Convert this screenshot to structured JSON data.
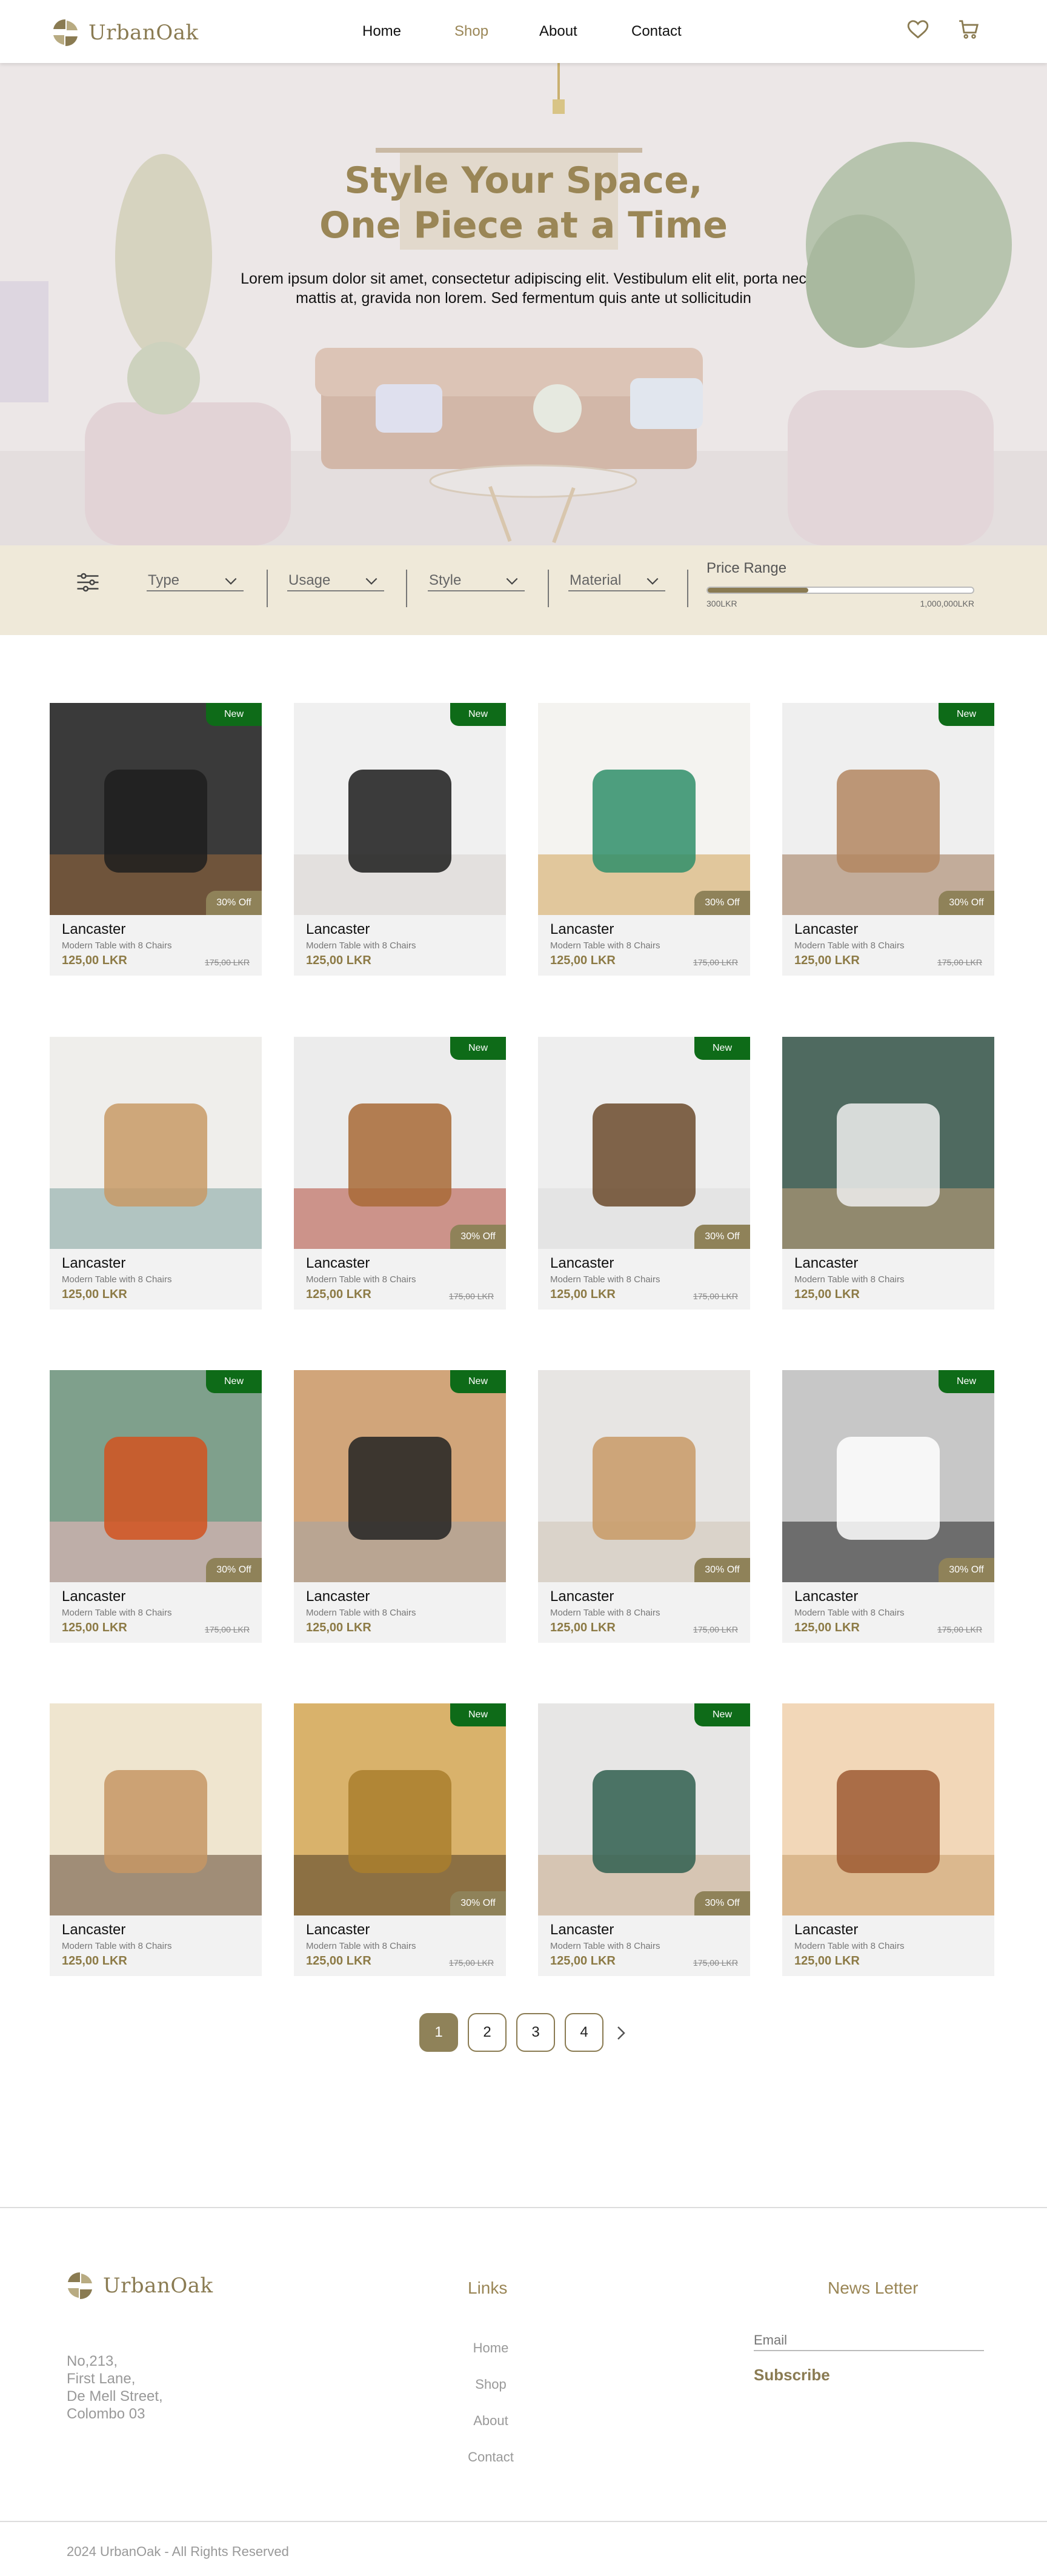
{
  "header": {
    "brand": "UrbanOak",
    "nav": [
      {
        "label": "Home",
        "active": false
      },
      {
        "label": "Shop",
        "active": true
      },
      {
        "label": "About",
        "active": false
      },
      {
        "label": "Contact",
        "active": false
      }
    ],
    "icons": [
      "heart-icon",
      "cart-icon"
    ]
  },
  "hero": {
    "title_line1": "Style Your Space,",
    "title_line2": "One Piece at a Time",
    "subtitle": "Lorem ipsum dolor sit amet, consectetur adipiscing elit. Vestibulum elit elit, porta nec mattis at, gravida non lorem. Sed fermentum quis ante ut sollicitudin"
  },
  "filters": {
    "selects": [
      "Type",
      "Usage",
      "Style",
      "Material"
    ],
    "price_range": {
      "label": "Price Range",
      "min_label": "300LKR",
      "max_label": "1,000,000LKR",
      "selected_fraction": 0.38
    }
  },
  "products": [
    {
      "name": "Lancaster",
      "desc": "Modern Table with 8 Chairs",
      "price": "125,00 LKR",
      "old_price": "175,00 LKR",
      "new": true,
      "discount": "30% Off"
    },
    {
      "name": "Lancaster",
      "desc": "Modern Table with 8 Chairs",
      "price": "125,00 LKR",
      "old_price": "",
      "new": true,
      "discount": ""
    },
    {
      "name": "Lancaster",
      "desc": "Modern Table with 8 Chairs",
      "price": "125,00 LKR",
      "old_price": "175,00 LKR",
      "new": false,
      "discount": "30% Off"
    },
    {
      "name": "Lancaster",
      "desc": "Modern Table with 8 Chairs",
      "price": "125,00 LKR",
      "old_price": "175,00 LKR",
      "new": true,
      "discount": "30% Off"
    },
    {
      "name": "Lancaster",
      "desc": "Modern Table with 8 Chairs",
      "price": "125,00 LKR",
      "old_price": "",
      "new": false,
      "discount": ""
    },
    {
      "name": "Lancaster",
      "desc": "Modern Table with 8 Chairs",
      "price": "125,00 LKR",
      "old_price": "175,00 LKR",
      "new": true,
      "discount": "30% Off"
    },
    {
      "name": "Lancaster",
      "desc": "Modern Table with 8 Chairs",
      "price": "125,00 LKR",
      "old_price": "175,00 LKR",
      "new": true,
      "discount": "30% Off"
    },
    {
      "name": "Lancaster",
      "desc": "Modern Table with 8 Chairs",
      "price": "125,00 LKR",
      "old_price": "",
      "new": false,
      "discount": ""
    },
    {
      "name": "Lancaster",
      "desc": "Modern Table with 8 Chairs",
      "price": "125,00 LKR",
      "old_price": "175,00 LKR",
      "new": true,
      "discount": "30% Off"
    },
    {
      "name": "Lancaster",
      "desc": "Modern Table with 8 Chairs",
      "price": "125,00 LKR",
      "old_price": "",
      "new": true,
      "discount": ""
    },
    {
      "name": "Lancaster",
      "desc": "Modern Table with 8 Chairs",
      "price": "125,00 LKR",
      "old_price": "175,00 LKR",
      "new": false,
      "discount": "30% Off"
    },
    {
      "name": "Lancaster",
      "desc": "Modern Table with 8 Chairs",
      "price": "125,00 LKR",
      "old_price": "175,00 LKR",
      "new": true,
      "discount": "30% Off"
    },
    {
      "name": "Lancaster",
      "desc": "Modern Table with 8 Chairs",
      "price": "125,00 LKR",
      "old_price": "",
      "new": false,
      "discount": ""
    },
    {
      "name": "Lancaster",
      "desc": "Modern Table with 8 Chairs",
      "price": "125,00 LKR",
      "old_price": "175,00 LKR",
      "new": true,
      "discount": "30% Off"
    },
    {
      "name": "Lancaster",
      "desc": "Modern Table with 8 Chairs",
      "price": "125,00 LKR",
      "old_price": "175,00 LKR",
      "new": true,
      "discount": "30% Off"
    },
    {
      "name": "Lancaster",
      "desc": "Modern Table with 8 Chairs",
      "price": "125,00 LKR",
      "old_price": "",
      "new": false,
      "discount": ""
    }
  ],
  "pagination": {
    "pages": [
      "1",
      "2",
      "3",
      "4"
    ],
    "current": "1",
    "next_icon": "chevron-right-icon"
  },
  "footer": {
    "brand": "UrbanOak",
    "address": [
      "No,213,",
      "First Lane,",
      "De Mell Street,",
      "Colombo 03"
    ],
    "links_title": "Links",
    "links": [
      "Home",
      "Shop",
      "About",
      "Contact"
    ],
    "newsletter_title": "News Letter",
    "email_placeholder": "Email",
    "subscribe_label": "Subscribe",
    "copyright": "2024 UrbanOak - All Rights Reserved"
  },
  "colors": {
    "accent": "#8f8259",
    "accent_text": "#9a8656",
    "new_badge": "#0e6b18",
    "filter_bar": "#efe9d9",
    "card_bg": "#f2f2f2"
  }
}
